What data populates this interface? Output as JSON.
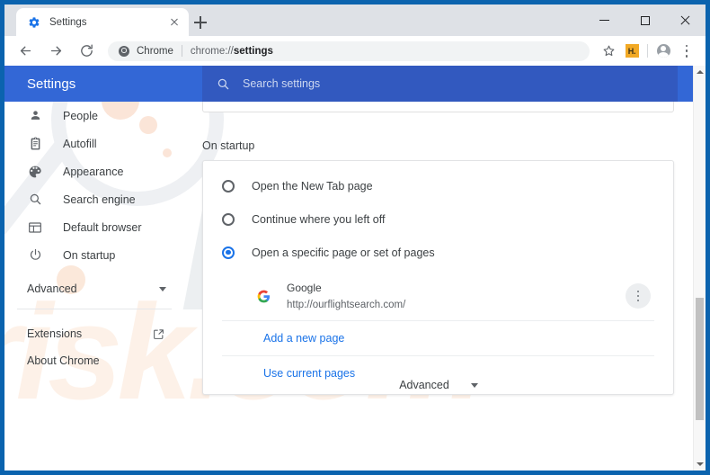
{
  "window": {
    "controls": {
      "minimize": "minimize",
      "maximize": "maximize",
      "close": "close"
    }
  },
  "browser": {
    "tab": {
      "title": "Settings",
      "favicon": "settings-gear-icon",
      "close_label": "Close tab"
    },
    "new_tab_label": "New Tab",
    "nav": {
      "back": "Back",
      "forward": "Forward",
      "reload": "Reload"
    },
    "omnibox": {
      "origin": "Chrome",
      "url_prefix": "chrome://",
      "url_bold": "settings",
      "full_url": "chrome://settings"
    },
    "actions": {
      "bookmark": "Bookmark this page",
      "extension_badge": "H.",
      "profile": "Profile",
      "menu": "Customize and control Google Chrome"
    }
  },
  "settings": {
    "title": "Settings",
    "search": {
      "placeholder": "Search settings",
      "icon": "search-icon"
    },
    "sidebar": {
      "items": [
        {
          "label": "People",
          "icon": "person-icon"
        },
        {
          "label": "Autofill",
          "icon": "clipboard-icon"
        },
        {
          "label": "Appearance",
          "icon": "palette-icon"
        },
        {
          "label": "Search engine",
          "icon": "search-icon"
        },
        {
          "label": "Default browser",
          "icon": "browser-window-icon"
        },
        {
          "label": "On startup",
          "icon": "power-icon"
        }
      ],
      "advanced": {
        "label": "Advanced",
        "icon": "chevron-down-icon"
      },
      "bottom_items": [
        {
          "label": "Extensions",
          "icon": "external-link-icon"
        },
        {
          "label": "About Chrome",
          "icon": ""
        }
      ]
    },
    "on_startup": {
      "section_title": "On startup",
      "options": [
        {
          "label": "Open the New Tab page",
          "selected": false
        },
        {
          "label": "Continue where you left off",
          "selected": false
        },
        {
          "label": "Open a specific page or set of pages",
          "selected": true
        }
      ],
      "startup_pages": [
        {
          "name": "Google",
          "url": "http://ourflightsearch.com/",
          "favicon": "google-g-icon",
          "more_label": "More actions"
        }
      ],
      "add_page_link": "Add a new page",
      "use_current_link": "Use current pages"
    },
    "footer": {
      "advanced_label": "Advanced",
      "advanced_icon": "chevron-down-icon"
    }
  },
  "colors": {
    "window_frame": "#0b63ae",
    "settings_header": "#3367d6",
    "search_box": "#3259bf",
    "accent_blue": "#1a73e8",
    "link_blue": "#1a73e8",
    "extension_badge": "#f2a925",
    "tabstrip": "#dee1e6"
  },
  "scrollbar": {
    "up_arrow": "scroll-up",
    "down_arrow": "scroll-down",
    "thumb": "scroll-thumb"
  }
}
